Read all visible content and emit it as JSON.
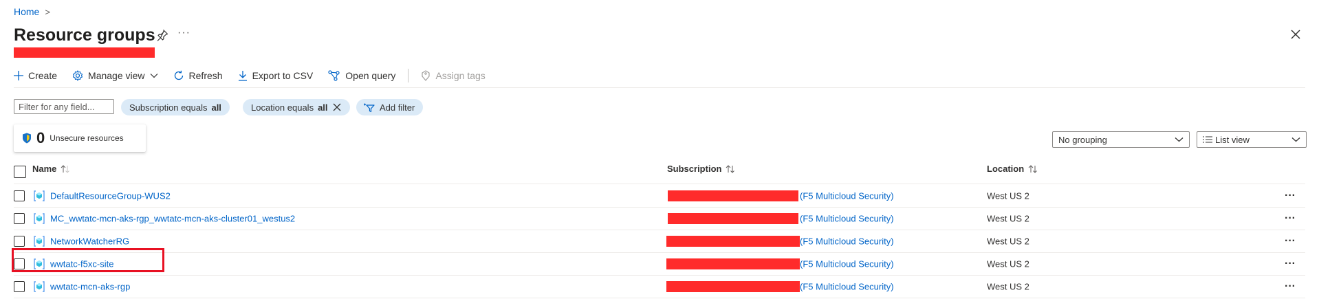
{
  "breadcrumb": {
    "home": "Home",
    "separator": ">"
  },
  "header": {
    "title": "Resource groups",
    "more": "···"
  },
  "toolbar": {
    "create": "Create",
    "manage_view": "Manage view",
    "refresh": "Refresh",
    "export": "Export to CSV",
    "open_query": "Open query",
    "assign_tags": "Assign tags"
  },
  "filters": {
    "placeholder": "Filter for any field...",
    "subscription_prefix": "Subscription equals",
    "subscription_value": "all",
    "location_prefix": "Location equals",
    "location_value": "all",
    "add_filter": "Add filter"
  },
  "security": {
    "count": "0",
    "label": "Unsecure resources"
  },
  "grouping": {
    "value": "No grouping"
  },
  "view": {
    "value": "List view"
  },
  "table": {
    "columns": {
      "name": "Name",
      "subscription": "Subscription",
      "location": "Location"
    },
    "rows": [
      {
        "name": "DefaultResourceGroup-WUS2",
        "subscription": "(F5 Multicloud Security)",
        "location": "West US 2",
        "more": "···"
      },
      {
        "name": "MC_wwtatc-mcn-aks-rgp_wwtatc-mcn-aks-cluster01_westus2",
        "subscription": "(F5 Multicloud Security)",
        "location": "West US 2",
        "more": "···"
      },
      {
        "name": "NetworkWatcherRG",
        "subscription": "(F5 Multicloud Security)",
        "location": "West US 2",
        "more": "···"
      },
      {
        "name": "wwtatc-f5xc-site",
        "subscription": "(F5 Multicloud Security)",
        "location": "West US 2",
        "more": "···"
      },
      {
        "name": "wwtatc-mcn-aks-rgp",
        "subscription": "(F5 Multicloud Security)",
        "location": "West US 2",
        "more": "···"
      }
    ]
  },
  "icons": {
    "pin": "pin-icon",
    "close": "close-icon",
    "create": "plus-icon",
    "manage_view": "gear-icon",
    "refresh": "refresh-icon",
    "export": "download-icon",
    "open_query": "query-icon",
    "assign_tags": "tag-icon",
    "add_filter": "filter-add-icon",
    "shield": "shield-icon",
    "resource_group": "resource-group-icon",
    "sort": "sort-icon",
    "dismiss": "dismiss-icon",
    "chevron": "chevron-down-icon"
  },
  "colors": {
    "link": "#0064c8",
    "pill": "#dbeaf7",
    "redaction": "#ff2b2b",
    "highlight": "#e81123"
  }
}
